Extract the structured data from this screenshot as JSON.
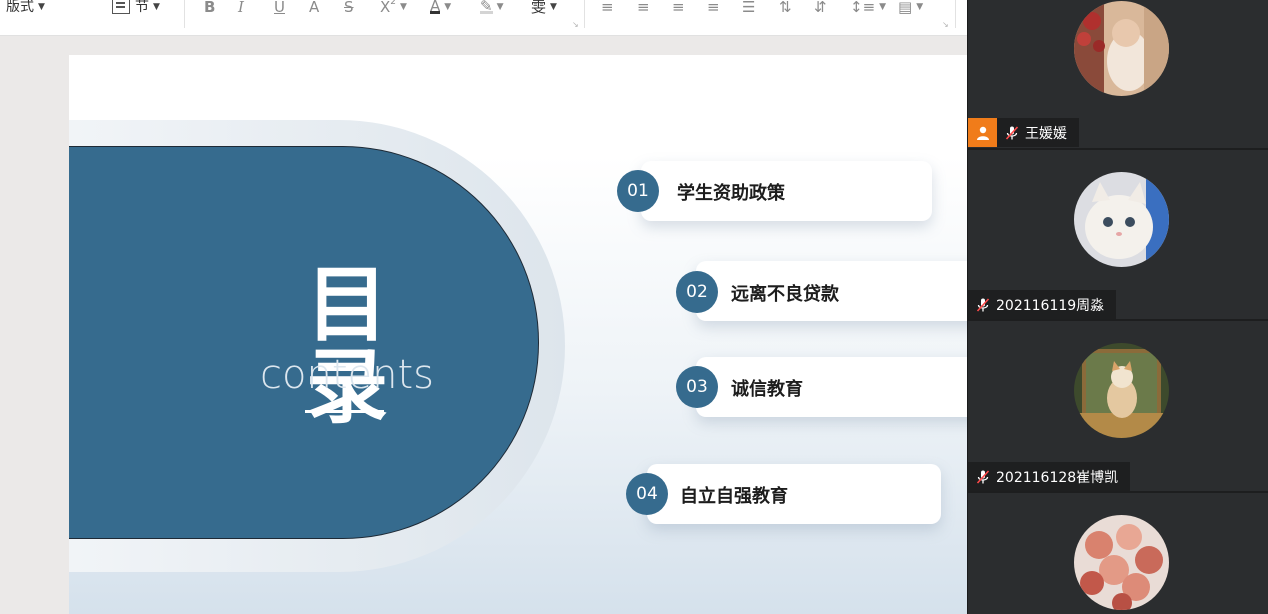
{
  "toolbar": {
    "layout_label": "版式",
    "section_label": "节",
    "icons": [
      "bold-icon",
      "italic-icon",
      "underline-icon",
      "shadow-icon",
      "strikethrough-icon",
      "superscript-icon",
      "font-color-icon",
      "highlight-icon",
      "phonetic-icon",
      "align-left-icon",
      "align-center-icon",
      "align-right-icon",
      "justify-icon",
      "distributed-icon",
      "increase-indent-icon",
      "decrease-indent-icon",
      "line-spacing-icon",
      "paragraph-icon"
    ],
    "font_color": "#333333",
    "highlight_color": "#d4d4d4"
  },
  "slide": {
    "title_cn": "目录",
    "title_en": "contents",
    "accent_color": "#366b8e",
    "items": [
      {
        "num": "01",
        "label": "学生资助政策"
      },
      {
        "num": "02",
        "label": "远离不良贷款"
      },
      {
        "num": "03",
        "label": "诚信教育"
      },
      {
        "num": "04",
        "label": "自立自强教育"
      }
    ]
  },
  "participants": [
    {
      "name": "王媛媛",
      "host": true,
      "muted": true,
      "avatar": "roses-portrait-avatar"
    },
    {
      "name": "202116119周淼",
      "host": false,
      "muted": true,
      "avatar": "white-kitten-avatar"
    },
    {
      "name": "202116128崔博凯",
      "host": false,
      "muted": true,
      "avatar": "cat-window-avatar"
    },
    {
      "name": "",
      "host": false,
      "muted": false,
      "avatar": "rose-bouquet-avatar"
    }
  ],
  "colors": {
    "panel_bg": "#2b2d2f",
    "host_badge": "#f07c1a",
    "slide_accent": "#366b8e"
  }
}
